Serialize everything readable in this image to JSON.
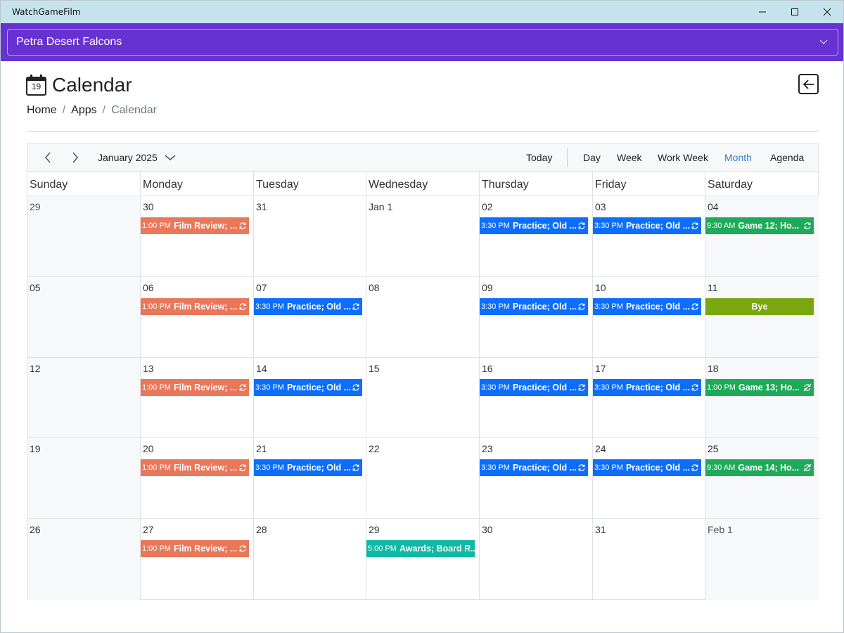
{
  "window": {
    "title": "WatchGameFilm"
  },
  "team": {
    "name": "Petra Desert Falcons"
  },
  "page": {
    "title": "Calendar",
    "calendar_icon_day": "19",
    "breadcrumb": [
      "Home",
      "Apps",
      "Calendar"
    ]
  },
  "toolbar": {
    "month_label": "January 2025",
    "today_label": "Today",
    "views": [
      "Day",
      "Week",
      "Work Week",
      "Month",
      "Agenda"
    ],
    "active_view": "Month"
  },
  "days_of_week": [
    "Sunday",
    "Monday",
    "Tuesday",
    "Wednesday",
    "Thursday",
    "Friday",
    "Saturday"
  ],
  "colors": {
    "film_review": "#e9775a",
    "practice": "#0d6efd",
    "game": "#1faa5a",
    "bye": "#7aa60f",
    "awards": "#10b9a4"
  },
  "weeks": [
    [
      {
        "label": "29",
        "other": true,
        "events": []
      },
      {
        "label": "30",
        "events": [
          {
            "time": "1:00 PM",
            "title": "Film Review; ...",
            "kind": "film_review",
            "icon": "recurring-icon"
          }
        ]
      },
      {
        "label": "31",
        "events": []
      },
      {
        "label": "Jan 1",
        "events": []
      },
      {
        "label": "02",
        "events": [
          {
            "time": "3:30 PM",
            "title": "Practice; Old ...",
            "kind": "practice",
            "icon": "recurring-icon"
          }
        ]
      },
      {
        "label": "03",
        "events": [
          {
            "time": "3:30 PM",
            "title": "Practice; Old ...",
            "kind": "practice",
            "icon": "recurring-icon"
          }
        ]
      },
      {
        "label": "04",
        "events": [
          {
            "time": "9:30 AM",
            "title": "Game 12; Ho...",
            "kind": "game",
            "icon": "recurring-icon"
          }
        ]
      }
    ],
    [
      {
        "label": "05",
        "events": []
      },
      {
        "label": "06",
        "events": [
          {
            "time": "1:00 PM",
            "title": "Film Review; ...",
            "kind": "film_review",
            "icon": "recurring-icon"
          }
        ]
      },
      {
        "label": "07",
        "events": [
          {
            "time": "3:30 PM",
            "title": "Practice; Old ...",
            "kind": "practice",
            "icon": "recurring-icon"
          }
        ]
      },
      {
        "label": "08",
        "events": []
      },
      {
        "label": "09",
        "events": [
          {
            "time": "3:30 PM",
            "title": "Practice; Old ...",
            "kind": "practice",
            "icon": "recurring-icon"
          }
        ]
      },
      {
        "label": "10",
        "events": [
          {
            "time": "3:30 PM",
            "title": "Practice; Old ...",
            "kind": "practice",
            "icon": "recurring-icon"
          }
        ]
      },
      {
        "label": "11",
        "events": [
          {
            "time": "",
            "title": "Bye",
            "kind": "bye",
            "icon": ""
          }
        ]
      }
    ],
    [
      {
        "label": "12",
        "events": []
      },
      {
        "label": "13",
        "events": [
          {
            "time": "1:00 PM",
            "title": "Film Review; ...",
            "kind": "film_review",
            "icon": "recurring-icon"
          }
        ]
      },
      {
        "label": "14",
        "events": [
          {
            "time": "3:30 PM",
            "title": "Practice; Old ...",
            "kind": "practice",
            "icon": "recurring-icon"
          }
        ]
      },
      {
        "label": "15",
        "events": []
      },
      {
        "label": "16",
        "events": [
          {
            "time": "3:30 PM",
            "title": "Practice; Old ...",
            "kind": "practice",
            "icon": "recurring-icon"
          }
        ]
      },
      {
        "label": "17",
        "events": [
          {
            "time": "3:30 PM",
            "title": "Practice; Old ...",
            "kind": "practice",
            "icon": "recurring-icon"
          }
        ]
      },
      {
        "label": "18",
        "events": [
          {
            "time": "1:00 PM",
            "title": "Game 13; Ho...",
            "kind": "game",
            "icon": "recurring-exception-icon"
          }
        ]
      }
    ],
    [
      {
        "label": "19",
        "events": []
      },
      {
        "label": "20",
        "events": [
          {
            "time": "1:00 PM",
            "title": "Film Review; ...",
            "kind": "film_review",
            "icon": "recurring-icon"
          }
        ]
      },
      {
        "label": "21",
        "events": [
          {
            "time": "3:30 PM",
            "title": "Practice; Old ...",
            "kind": "practice",
            "icon": "recurring-icon"
          }
        ]
      },
      {
        "label": "22",
        "events": []
      },
      {
        "label": "23",
        "events": [
          {
            "time": "3:30 PM",
            "title": "Practice; Old ...",
            "kind": "practice",
            "icon": "recurring-icon"
          }
        ]
      },
      {
        "label": "24",
        "events": [
          {
            "time": "3:30 PM",
            "title": "Practice; Old ...",
            "kind": "practice",
            "icon": "recurring-icon"
          }
        ]
      },
      {
        "label": "25",
        "events": [
          {
            "time": "9:30 AM",
            "title": "Game 14; Ho...",
            "kind": "game",
            "icon": "recurring-exception-icon"
          }
        ]
      }
    ],
    [
      {
        "label": "26",
        "events": []
      },
      {
        "label": "27",
        "events": [
          {
            "time": "1:00 PM",
            "title": "Film Review; ...",
            "kind": "film_review",
            "icon": "recurring-icon"
          }
        ]
      },
      {
        "label": "28",
        "events": []
      },
      {
        "label": "29",
        "events": [
          {
            "time": "5:00 PM",
            "title": "Awards; Board R...",
            "kind": "awards",
            "icon": ""
          }
        ]
      },
      {
        "label": "30",
        "events": []
      },
      {
        "label": "31",
        "events": []
      },
      {
        "label": "Feb 1",
        "other": true,
        "events": []
      }
    ]
  ]
}
